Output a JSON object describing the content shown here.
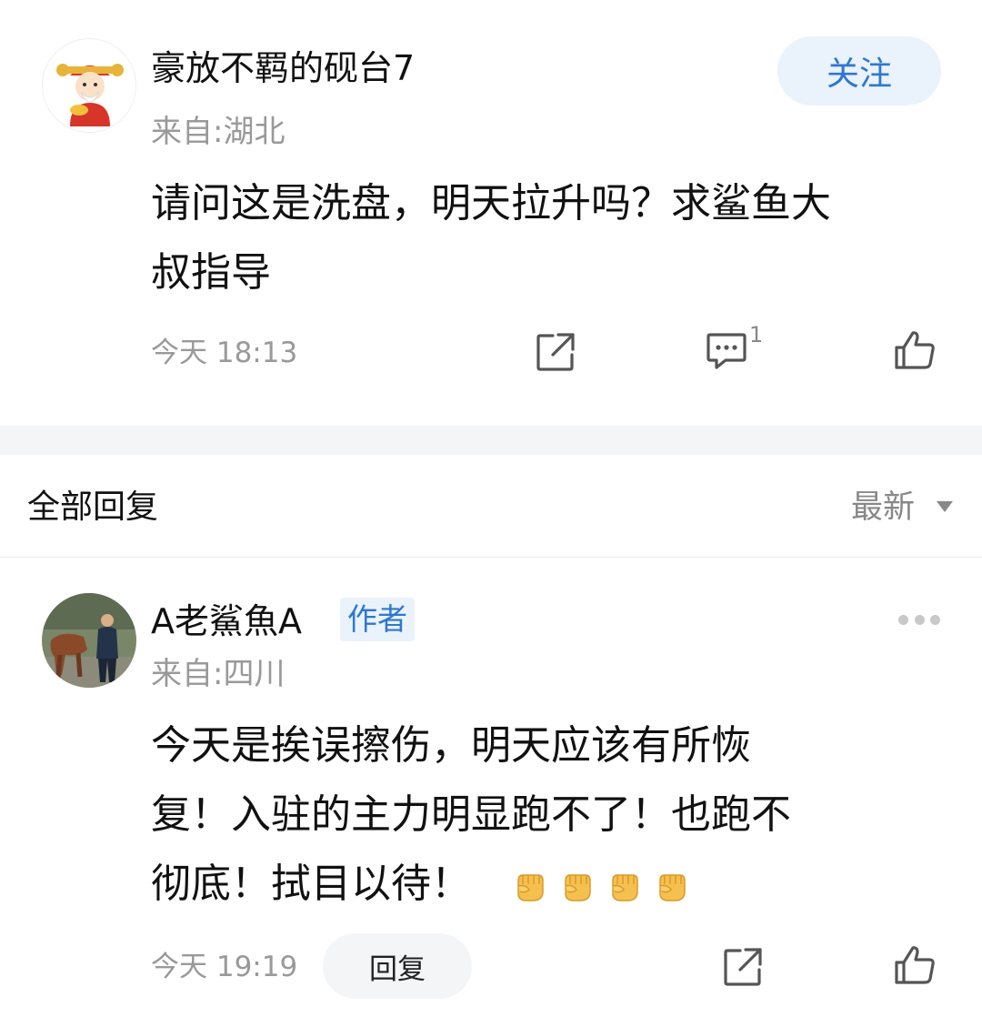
{
  "post": {
    "username": "豪放不羁的砚台7",
    "location": "来自:湖北",
    "follow_label": "关注",
    "content_line1": "请问这是洗盘，明天拉升吗？求鲨鱼大",
    "content_line2": "叔指导",
    "time": "今天 18:13",
    "comment_count": "1",
    "icons": {
      "share": "share-icon",
      "comment": "comment-icon",
      "like": "thumbs-up-icon"
    }
  },
  "replies_header": {
    "title": "全部回复",
    "sort_label": "最新"
  },
  "reply": {
    "username": "A老鯊魚A",
    "badge": "作者",
    "location": "来自:四川",
    "content_line1": "今天是挨误擦伤，明天应该有所恢",
    "content_line2": "复！入驻的主力明显跑不了！也跑不",
    "content_line3": "彻底！拭目以待！",
    "emoji_count": 4,
    "time": "今天 19:19",
    "reply_label": "回复",
    "icons": {
      "more": "more-dots-icon",
      "share": "share-icon",
      "like": "thumbs-up-icon"
    }
  },
  "colors": {
    "accent": "#2e77d0",
    "accent_bg": "#eaf2fb",
    "muted": "#999999",
    "band": "#f4f5f7"
  }
}
